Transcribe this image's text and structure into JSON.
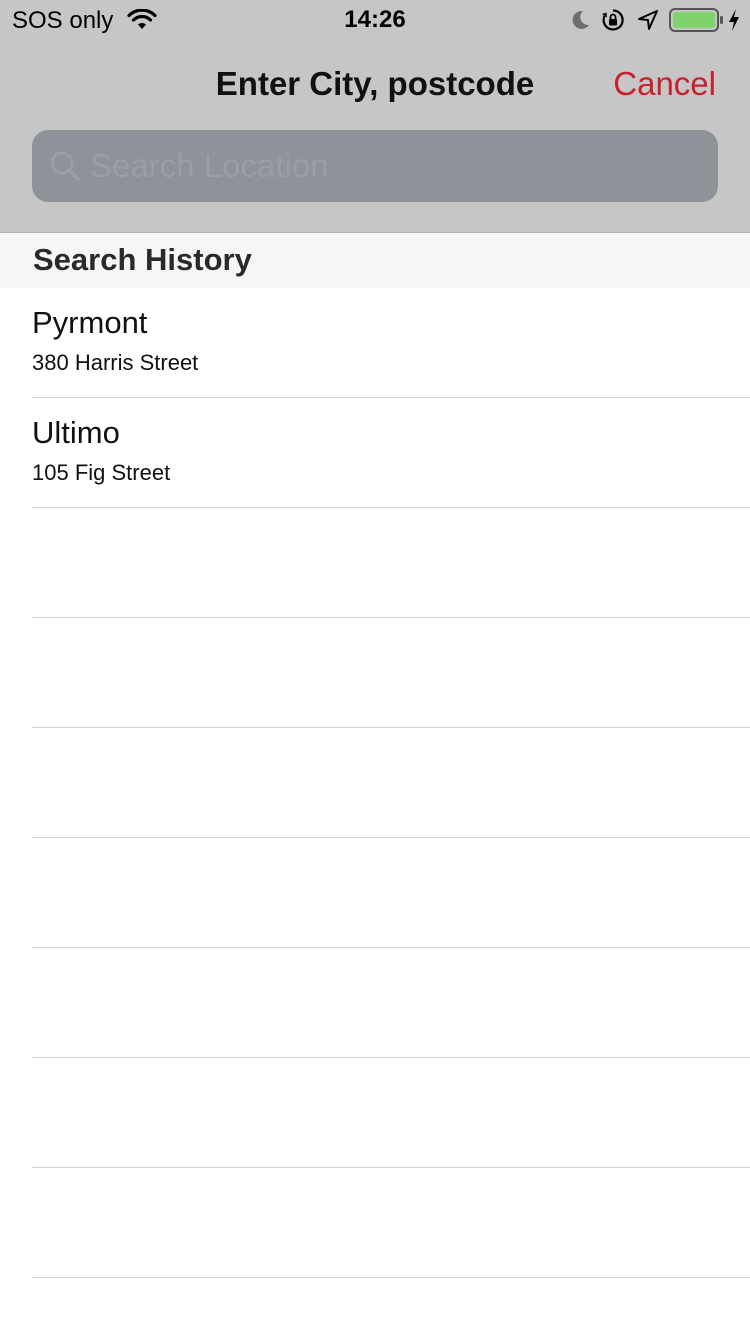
{
  "status_bar": {
    "carrier": "SOS only",
    "time": "14:26",
    "battery_color": "#7ed36a",
    "icons": [
      "wifi-icon",
      "moon-icon",
      "lock-rotation-icon",
      "location-icon",
      "battery-icon",
      "charging-icon"
    ]
  },
  "nav": {
    "title": "Enter City, postcode",
    "cancel_label": "Cancel",
    "accent_color": "#c8202f"
  },
  "search": {
    "value": "",
    "placeholder": "Search Location"
  },
  "history": {
    "header": "Search History",
    "items": [
      {
        "title": "Pyrmont",
        "subtitle": "380 Harris Street"
      },
      {
        "title": "Ultimo",
        "subtitle": "105 Fig Street"
      }
    ],
    "empty_rows": 7
  }
}
